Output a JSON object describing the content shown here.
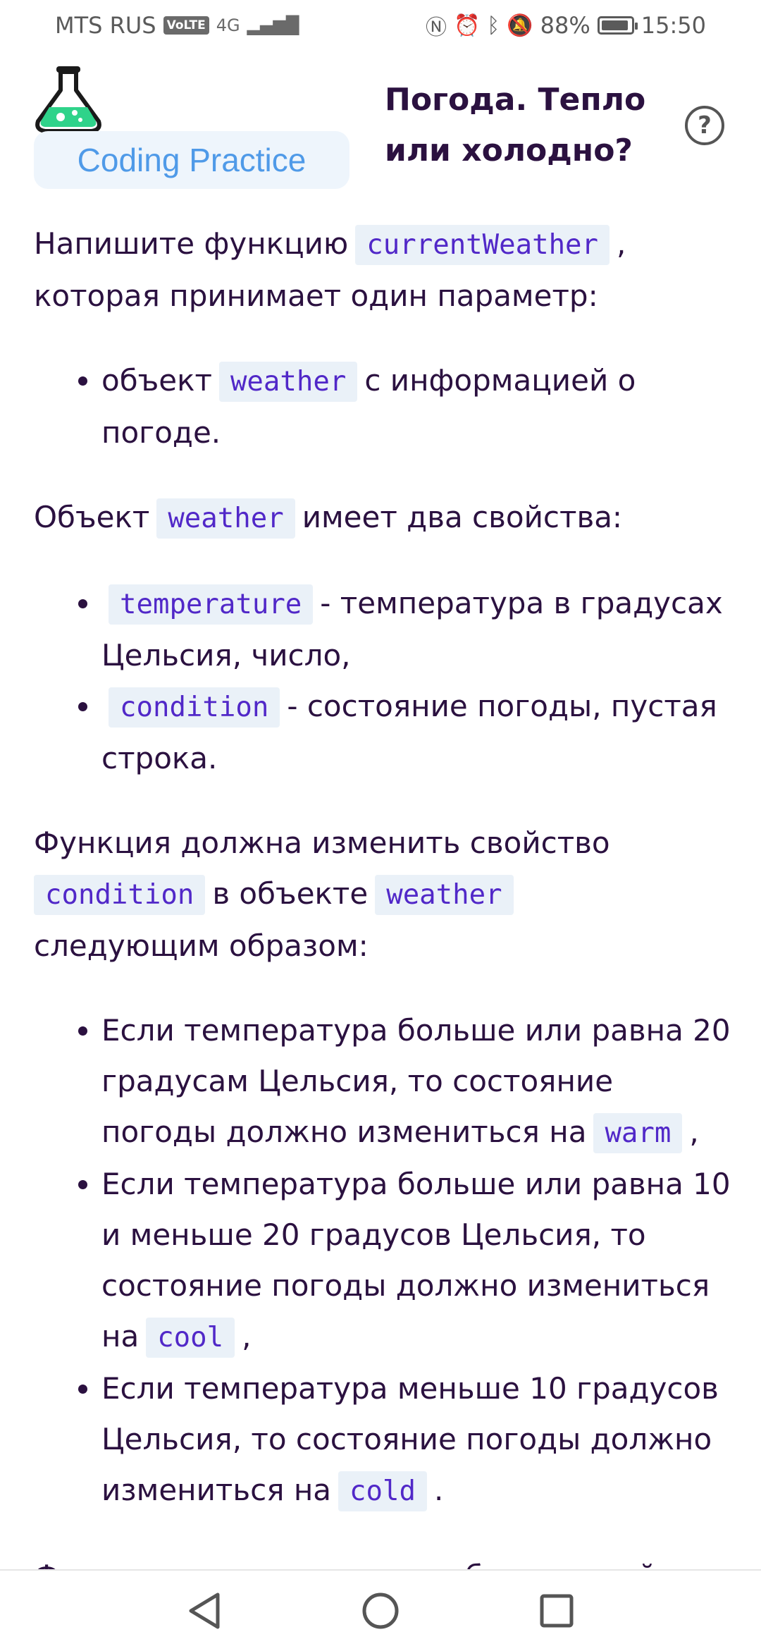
{
  "status_bar": {
    "carrier": "MTS RUS",
    "volte": "VoLTE",
    "network": "4G",
    "battery": "88%",
    "time": "15:50"
  },
  "header": {
    "brand": "Coding Practice",
    "title": "Погода. Тепло или холодно?",
    "help": "?"
  },
  "content": {
    "p1": {
      "a": "Напишите функцию",
      "code": "currentWeather",
      "b": ",",
      "c": "которая принимает один параметр:"
    },
    "li1": {
      "a": "объект",
      "code": "weather",
      "b": "с информацией о погоде."
    },
    "p2": {
      "a": "Объект",
      "code": "weather",
      "b": "имеет два свойства:"
    },
    "li2": {
      "code": "temperature",
      "b": "- температура в градусах Цельсия, число,"
    },
    "li3": {
      "code": "condition",
      "b": "- состояние погоды, пустая строка."
    },
    "p3": {
      "a": "Функция должна изменить свойство",
      "code1": "condition",
      "b": "в объекте",
      "code2": "weather",
      "c": "следующим образом:"
    },
    "li4": {
      "a": "Если температура больше или равна 20 градусам Цельсия, то состояние погоды должно измениться на",
      "code": "warm",
      "b": ","
    },
    "li5": {
      "a": "Если температура больше или равна 10 и меньше 20 градусов Цельсия, то состояние погоды должно измениться на",
      "code": "cool",
      "b": ","
    },
    "li6": {
      "a": "Если температура меньше 10 градусов Цельсия, то состояние погоды должно измениться на",
      "code": "cold",
      "b": "."
    },
    "p4": "Функция должна вернуть обновленный"
  },
  "icons": {
    "logo": "flask-icon",
    "back": "back-triangle-icon",
    "home": "home-circle-icon",
    "recents": "recents-square-icon"
  },
  "colors": {
    "text": "#2b1140",
    "code": "#5128c8",
    "code_bg": "#eaf1f8",
    "brand": "#4f9ae8",
    "brand_bg": "#eef5fc",
    "logo_green": "#2fd38a"
  }
}
